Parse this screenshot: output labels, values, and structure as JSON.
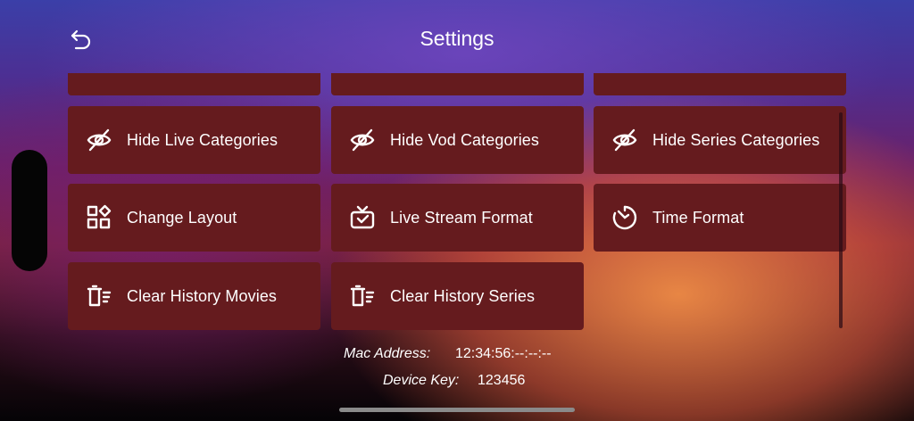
{
  "header": {
    "title": "Settings"
  },
  "tiles": [
    {
      "label": "Hide Live Categories",
      "icon": "eye-off-icon"
    },
    {
      "label": "Hide Vod Categories",
      "icon": "eye-off-icon"
    },
    {
      "label": "Hide Series Categories",
      "icon": "eye-off-icon"
    },
    {
      "label": "Change Layout",
      "icon": "layout-grid-icon"
    },
    {
      "label": "Live Stream Format",
      "icon": "tv-icon"
    },
    {
      "label": "Time Format",
      "icon": "clock-icon"
    },
    {
      "label": "Clear History Movies",
      "icon": "trash-list-icon"
    },
    {
      "label": "Clear History Series",
      "icon": "trash-list-icon"
    }
  ],
  "device": {
    "mac_label": "Mac Address:",
    "mac_value": "12:34:56:--:--:--",
    "key_label": "Device Key:",
    "key_value": "123456"
  },
  "colors": {
    "tile_background": "#651b1e",
    "text": "#ffffff"
  }
}
